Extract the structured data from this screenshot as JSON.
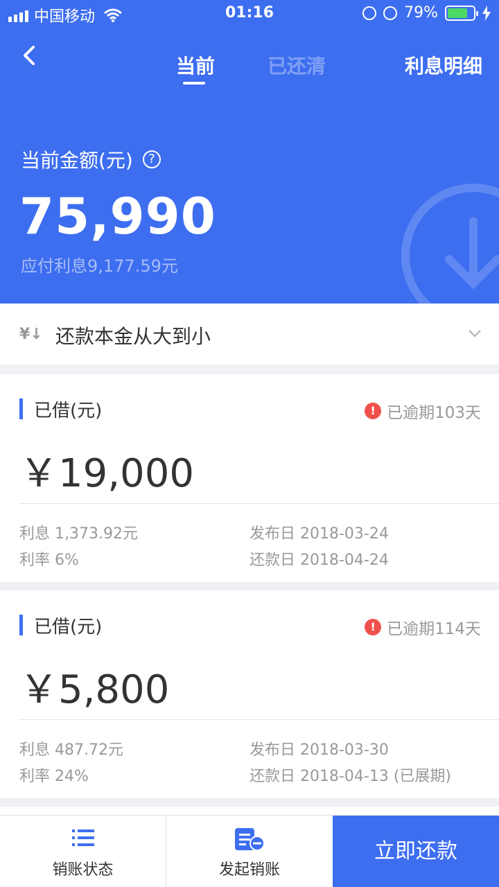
{
  "status_bar": {
    "carrier": "中国移动",
    "time": "01:16",
    "battery": "79%"
  },
  "nav": {
    "tab_current": "当前",
    "tab_cleared": "已还清",
    "interest_detail": "利息明细"
  },
  "summary": {
    "label": "当前金额(元)",
    "help_icon_glyph": "?",
    "amount": "75,990",
    "interest_payable": "应付利息9,177.59元"
  },
  "sort": {
    "icon_glyph": "¥↓",
    "label": "还款本金从大到小"
  },
  "loans": [
    {
      "title": "已借(元)",
      "overdue": "已逾期103天",
      "amount": "￥19,000",
      "interest": "利息 1,373.92元",
      "rate": "利率 6%",
      "publish_date": "发布日 2018-03-24",
      "repay_date": "还款日 2018-04-24"
    },
    {
      "title": "已借(元)",
      "overdue": "已逾期114天",
      "amount": "￥5,800",
      "interest": "利息 487.72元",
      "rate": "利率 24%",
      "publish_date": "发布日 2018-03-30",
      "repay_date": "还款日 2018-04-13 (已展期)"
    }
  ],
  "bottom_bar": {
    "status_label": "销账状态",
    "start_label": "发起销账",
    "repay_label": "立即还款"
  },
  "colors": {
    "primary": "#3d6ef0",
    "warning": "#f0514c",
    "battery": "#4cd964"
  },
  "icons": {
    "warning": "warning-icon",
    "back": "back-arrow-icon",
    "list": "list-icon",
    "document": "document-minus-icon"
  }
}
